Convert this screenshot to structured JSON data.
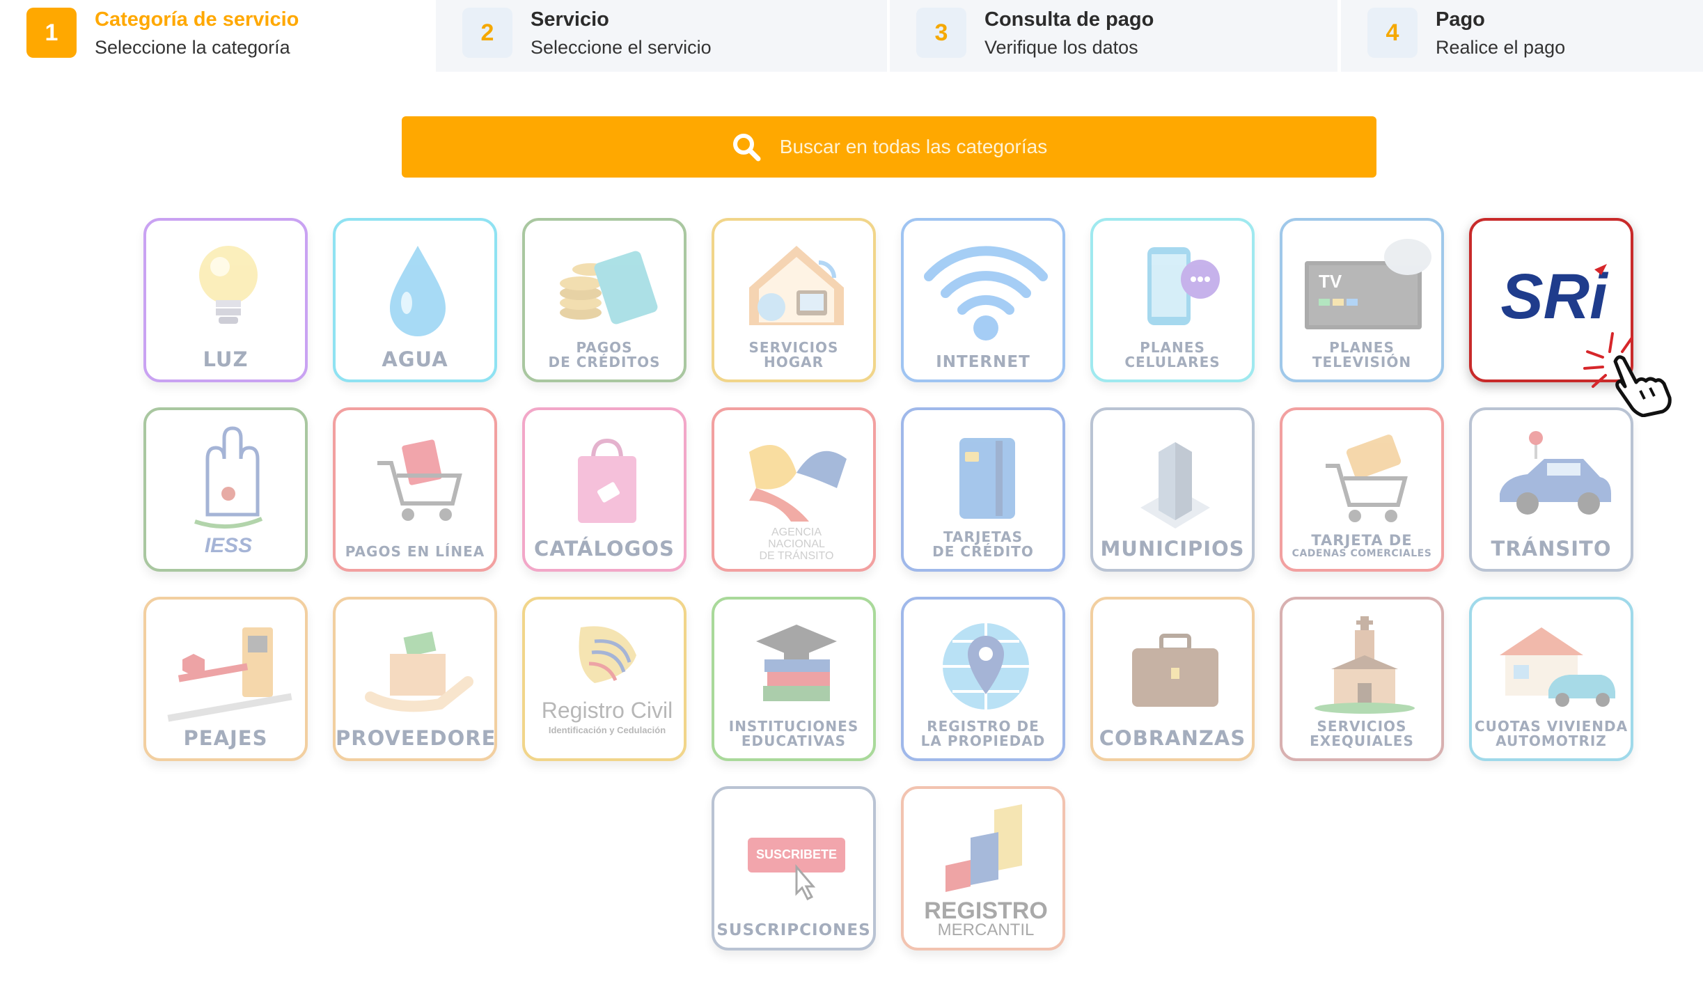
{
  "steps": [
    {
      "num": "1",
      "title": "Categoría de servicio",
      "sub": "Seleccione la categoría"
    },
    {
      "num": "2",
      "title": "Servicio",
      "sub": "Seleccione el servicio"
    },
    {
      "num": "3",
      "title": "Consulta de pago",
      "sub": "Verifique los datos"
    },
    {
      "num": "4",
      "title": "Pago",
      "sub": "Realice el pago"
    }
  ],
  "search": {
    "placeholder": "Buscar en todas las categorías",
    "icon": "search-icon"
  },
  "accent": "#ffa800",
  "tiles": {
    "luz": {
      "label": "LUZ",
      "border": "#c9a2f2"
    },
    "agua": {
      "label": "AGUA",
      "border": "#8fe2f2"
    },
    "creditos": {
      "l1": "PAGOS",
      "l2": "DE CRÉDITOS",
      "border": "#a9c7a0"
    },
    "hogar": {
      "l1": "SERVICIOS",
      "l2": "HOGAR",
      "border": "#f1d58a"
    },
    "internet": {
      "label": "INTERNET",
      "border": "#9fc4f2"
    },
    "celulares": {
      "l1": "PLANES",
      "l2": "CELULARES",
      "border": "#9fe9ef"
    },
    "television": {
      "l1": "PLANES",
      "l2": "TELEVISIÓN",
      "border": "#9fc8ea"
    },
    "sri": {
      "logo": "SRi",
      "border": "#c82a2a"
    },
    "iess": {
      "logo": "IESS",
      "border": "#a9c7a0"
    },
    "pagos_linea": {
      "label": "PAGOS EN LÍNEA",
      "border": "#f2a0a0"
    },
    "catalogos": {
      "label": "CATÁLOGOS",
      "border": "#f2a7c8"
    },
    "ant": {
      "l1": "AGENCIA",
      "l2": "NACIONAL",
      "l3": "DE TRÁNSITO",
      "border": "#f2a0a0"
    },
    "tarjetas": {
      "l1": "TARJETAS",
      "l2": "DE CRÉDITO",
      "border": "#9fb8ea"
    },
    "municipios": {
      "label": "MUNICIPIOS",
      "border": "#b9c3d3"
    },
    "cadenas": {
      "l1": "TARJETA DE",
      "l2": "CADENAS COMERCIALES",
      "border": "#f2a0a0"
    },
    "transito": {
      "label": "TRÁNSITO",
      "border": "#b9c3d3"
    },
    "peajes": {
      "label": "PEAJES",
      "border": "#f2cfa0"
    },
    "proveedores": {
      "label": "PROVEEDORES",
      "border": "#f2cfa0"
    },
    "registro_civil": {
      "l1": "Registro Civil",
      "l2": "Identificación y Cedulación",
      "border": "#f1d58a"
    },
    "educativas": {
      "l1": "INSTITUCIONES",
      "l2": "EDUCATIVAS",
      "border": "#a9d99a"
    },
    "propiedad": {
      "l1": "REGISTRO DE",
      "l2": "LA PROPIEDAD",
      "border": "#9fb8ea"
    },
    "cobranzas": {
      "label": "COBRANZAS",
      "border": "#f2cfa0"
    },
    "exequiales": {
      "l1": "SERVICIOS",
      "l2": "EXEQUIALES",
      "border": "#d8b0b0"
    },
    "vivienda": {
      "l1": "CUOTAS VIVIENDA",
      "l2": "AUTOMOTRIZ",
      "border": "#9fd9ea"
    },
    "suscripciones": {
      "label": "SUSCRIPCIONES",
      "button": "SUSCRIBETE",
      "border": "#b9c3d3"
    },
    "mercantil": {
      "l1": "REGISTRO",
      "l2": "MERCANTIL",
      "border": "#f2c3b0"
    }
  }
}
